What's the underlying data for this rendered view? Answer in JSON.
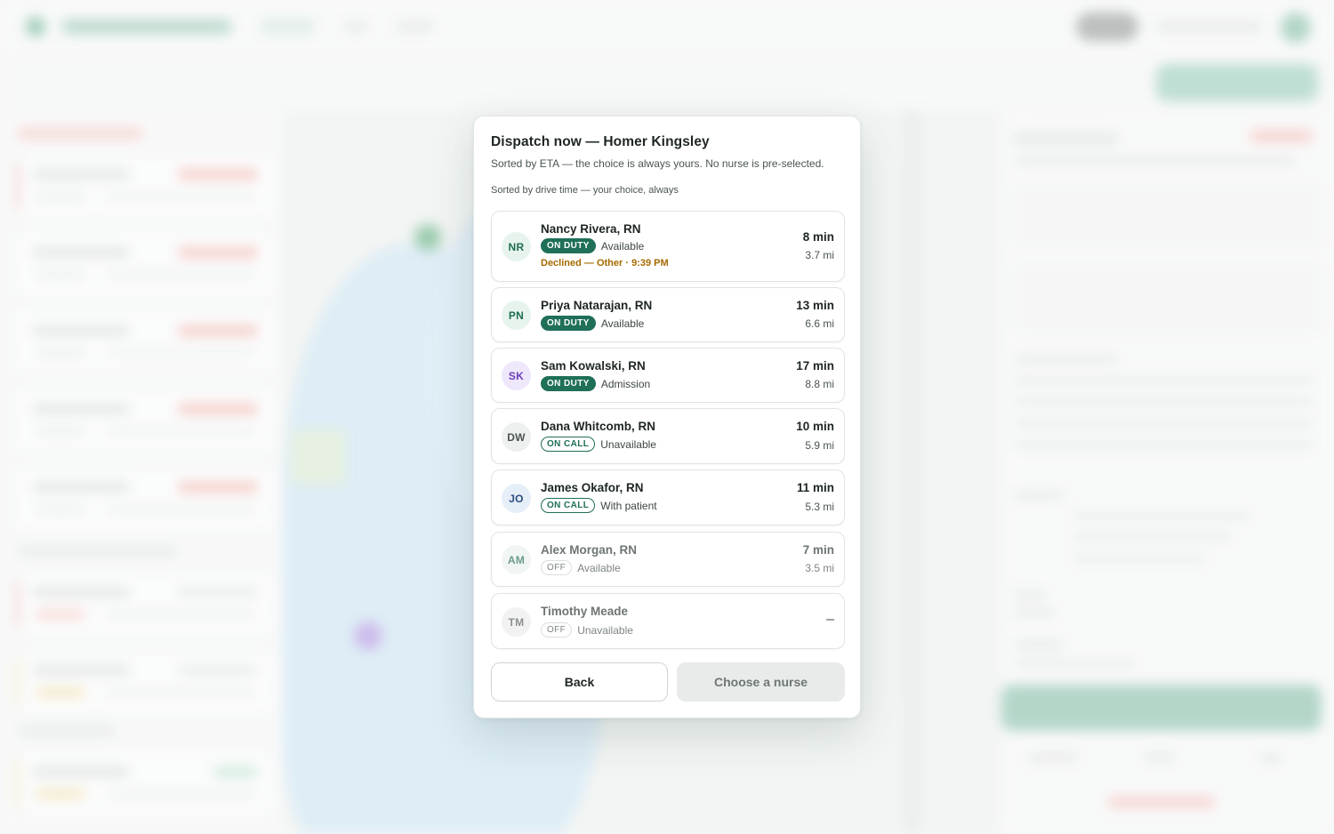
{
  "modal": {
    "title": "Dispatch now — Homer Kingsley",
    "subtitle": "Sorted by ETA — the choice is always yours. No nurse is pre-selected.",
    "sort_hint": "Sorted by drive time — your choice, always",
    "back_label": "Back",
    "choose_label": "Choose a nurse"
  },
  "nurses": [
    {
      "initials": "NR",
      "name": "Nancy Rivera, RN",
      "badge": "ON DUTY",
      "status": "Available",
      "note": "Declined — Other · 9:39 PM",
      "eta": "8 min",
      "distance": "3.7 mi"
    },
    {
      "initials": "PN",
      "name": "Priya Natarajan, RN",
      "badge": "ON DUTY",
      "status": "Available",
      "eta": "13 min",
      "distance": "6.6 mi"
    },
    {
      "initials": "SK",
      "name": "Sam Kowalski, RN",
      "badge": "ON DUTY",
      "status": "Admission",
      "eta": "17 min",
      "distance": "8.8 mi"
    },
    {
      "initials": "DW",
      "name": "Dana Whitcomb, RN",
      "badge": "ON CALL",
      "status": "Unavailable",
      "eta": "10 min",
      "distance": "5.9 mi"
    },
    {
      "initials": "JO",
      "name": "James Okafor, RN",
      "badge": "ON CALL",
      "status": "With patient",
      "eta": "11 min",
      "distance": "5.3 mi"
    },
    {
      "initials": "AM",
      "name": "Alex Morgan, RN",
      "badge": "OFF",
      "status": "Available",
      "eta": "7 min",
      "distance": "3.5 mi"
    },
    {
      "initials": "TM",
      "name": "Timothy Meade",
      "badge": "OFF",
      "status": "Unavailable",
      "eta": "–"
    }
  ],
  "colors": {
    "accent": "#1f6f59",
    "warning": "#a56b00",
    "button_disabled": "#e8ebea"
  }
}
